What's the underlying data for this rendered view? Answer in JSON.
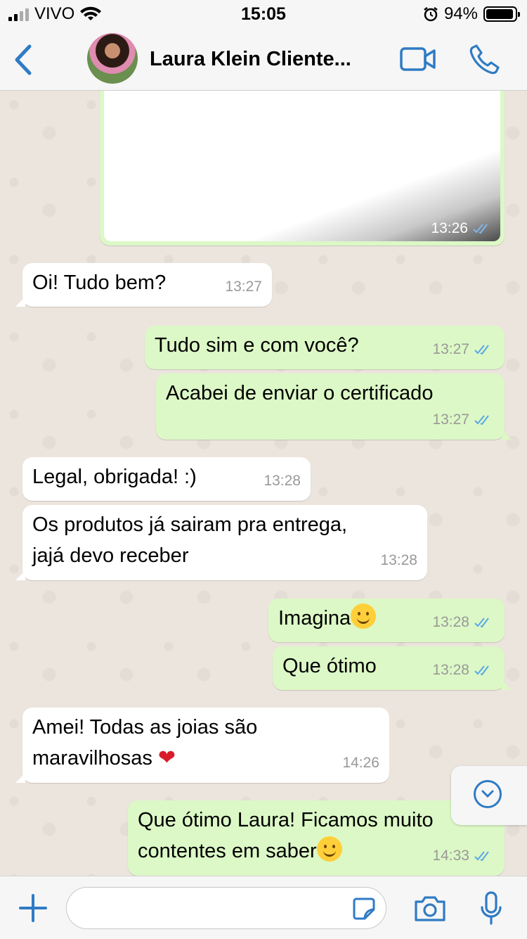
{
  "status": {
    "carrier": "VIVO",
    "time": "15:05",
    "battery": "94%"
  },
  "header": {
    "contact_name": "Laura Klein Cliente..."
  },
  "messages": [
    {
      "dir": "out",
      "type": "image",
      "time": "13:26"
    },
    {
      "dir": "in",
      "text": "Oi! Tudo bem?",
      "time": "13:27"
    },
    {
      "dir": "out",
      "text": "Tudo sim e com você?",
      "time": "13:27"
    },
    {
      "dir": "out",
      "text": "Acabei de enviar o certificado",
      "time": "13:27"
    },
    {
      "dir": "in",
      "text": "Legal, obrigada! :)",
      "time": "13:28"
    },
    {
      "dir": "in",
      "line1": "Os produtos já sairam pra entrega,",
      "line2": "jajá devo receber",
      "time": "13:28"
    },
    {
      "dir": "out",
      "text": "Imagina",
      "time": "13:28"
    },
    {
      "dir": "out",
      "text": "Que ótimo",
      "time": "13:28"
    },
    {
      "dir": "in",
      "line1": "Amei! Todas as joias são",
      "line2": "maravilhosas",
      "time": "14:26"
    },
    {
      "dir": "out",
      "line1": "Que ótimo Laura! Ficamos muito",
      "line2": "contentes em saber",
      "time": "14:33"
    }
  ],
  "icons": {
    "back": "chevron-left-icon",
    "video": "video-camera-icon",
    "call": "phone-icon",
    "plus": "plus-icon",
    "sticker": "sticker-icon",
    "camera": "camera-icon",
    "mic": "microphone-icon",
    "scroll": "chevron-down-icon"
  },
  "colors": {
    "accent": "#2f7bc4",
    "outgoing": "#dcf8c6",
    "incoming": "#ffffff",
    "read_ticks": "#5aa7e6"
  }
}
